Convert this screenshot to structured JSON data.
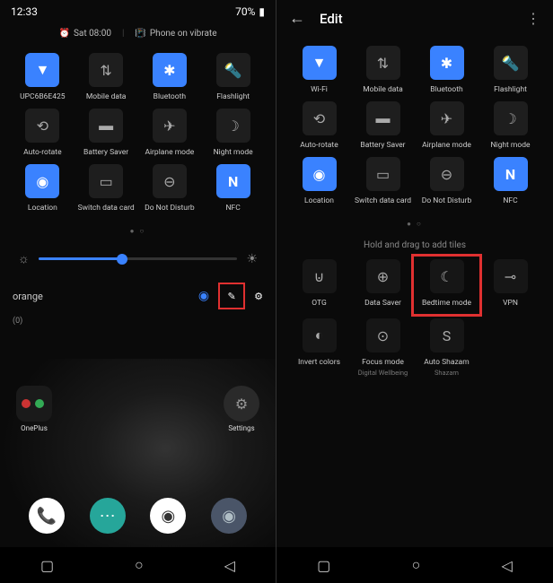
{
  "left": {
    "statusbar": {
      "time": "12:33",
      "battery": "70%"
    },
    "header": {
      "alarm": "Sat 08:00",
      "vibrate": "Phone on vibrate"
    },
    "tiles": [
      {
        "label": "UPC6B6E425",
        "icon": "wifi",
        "active": true
      },
      {
        "label": "Mobile data",
        "icon": "swap",
        "active": false
      },
      {
        "label": "Bluetooth",
        "icon": "bluetooth",
        "active": true
      },
      {
        "label": "Flashlight",
        "icon": "flashlight",
        "active": false
      },
      {
        "label": "Auto-rotate",
        "icon": "rotate",
        "active": false
      },
      {
        "label": "Battery Saver",
        "icon": "battery",
        "active": false
      },
      {
        "label": "Airplane mode",
        "icon": "airplane",
        "active": false
      },
      {
        "label": "Night mode",
        "icon": "moon",
        "active": false
      },
      {
        "label": "Location",
        "icon": "location",
        "active": true
      },
      {
        "label": "Switch data card",
        "icon": "sim",
        "active": false
      },
      {
        "label": "Do Not Disturb",
        "icon": "dnd",
        "active": false
      },
      {
        "label": "NFC",
        "icon": "nfc",
        "active": true
      }
    ],
    "carrier_name": "orange",
    "notification_count": "(0)",
    "apps": {
      "oneplus": "OnePlus",
      "settings": "Settings"
    }
  },
  "right": {
    "title": "Edit",
    "tiles": [
      {
        "label": "Wi-Fi",
        "icon": "wifi",
        "active": true
      },
      {
        "label": "Mobile data",
        "icon": "swap",
        "active": false
      },
      {
        "label": "Bluetooth",
        "icon": "bluetooth",
        "active": true
      },
      {
        "label": "Flashlight",
        "icon": "flashlight",
        "active": false
      },
      {
        "label": "Auto-rotate",
        "icon": "rotate",
        "active": false
      },
      {
        "label": "Battery Saver",
        "icon": "battery",
        "active": false
      },
      {
        "label": "Airplane mode",
        "icon": "airplane",
        "active": false
      },
      {
        "label": "Night mode",
        "icon": "moon",
        "active": false
      },
      {
        "label": "Location",
        "icon": "location",
        "active": true
      },
      {
        "label": "Switch data card",
        "icon": "sim",
        "active": false
      },
      {
        "label": "Do Not Disturb",
        "icon": "dnd",
        "active": false
      },
      {
        "label": "NFC",
        "icon": "nfc",
        "active": true
      }
    ],
    "hint": "Hold and drag to add tiles",
    "extra_tiles": [
      {
        "label": "OTG",
        "sub": "",
        "icon": "usb"
      },
      {
        "label": "Data Saver",
        "sub": "",
        "icon": "datasaver"
      },
      {
        "label": "Bedtime mode",
        "sub": "",
        "icon": "bedtime",
        "highlight": true
      },
      {
        "label": "VPN",
        "sub": "",
        "icon": "vpn"
      },
      {
        "label": "Invert colors",
        "sub": "",
        "icon": "invert"
      },
      {
        "label": "Focus mode",
        "sub": "Digital Wellbeing",
        "icon": "focus"
      },
      {
        "label": "Auto Shazam",
        "sub": "Shazam",
        "icon": "shazam"
      }
    ]
  },
  "colors": {
    "accent": "#3a82ff",
    "highlight": "#e03030"
  }
}
